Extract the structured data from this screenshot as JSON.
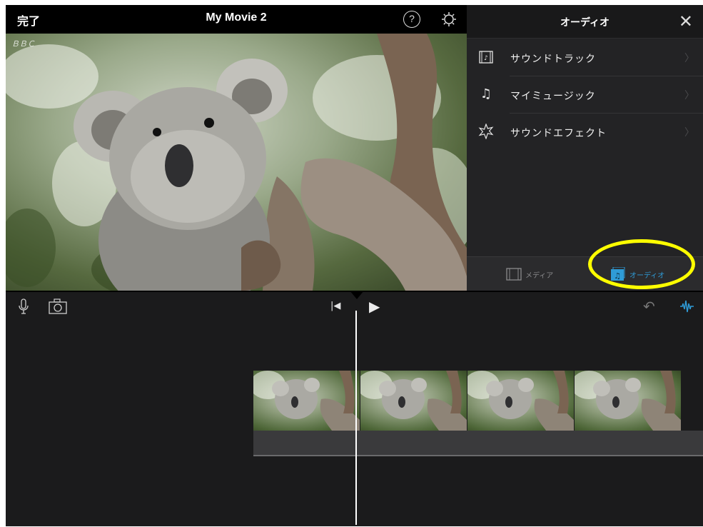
{
  "app": {
    "done_label": "完了",
    "title": "My Movie 2",
    "help_label": "?"
  },
  "preview": {
    "watermark": "ＢＢＣ"
  },
  "audio_panel": {
    "title": "オーディオ",
    "close_icon": "close-icon",
    "items": [
      {
        "label": "サウンドトラック",
        "icon": "film-music-icon"
      },
      {
        "label": "マイミュージック",
        "icon": "music-note-icon"
      },
      {
        "label": "サウンドエフェクト",
        "icon": "sound-effect-star-icon"
      }
    ],
    "tabs": [
      {
        "label": "メディア",
        "icon": "media-film-icon",
        "selected": false
      },
      {
        "label": "オーディオ",
        "icon": "audio-note-icon",
        "selected": true
      }
    ],
    "accent_color": "#2f9bd6",
    "highlight_color": "#ffff00"
  },
  "toolbar": {
    "icons": [
      "microphone-icon",
      "camera-icon",
      "skip-to-start-icon",
      "play-icon",
      "undo-icon",
      "audio-waveform-icon"
    ]
  },
  "timeline": {
    "clip_count": 4
  }
}
